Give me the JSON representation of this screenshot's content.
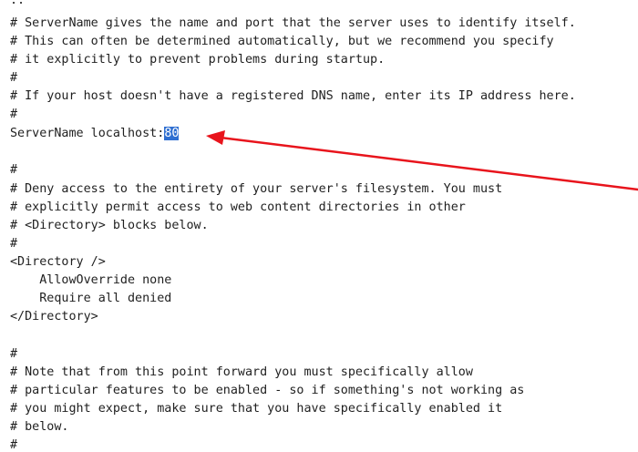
{
  "editor": {
    "lines": [
      "..",
      "# ServerName gives the name and port that the server uses to identify itself.",
      "# This can often be determined automatically, but we recommend you specify",
      "# it explicitly to prevent problems during startup.",
      "#",
      "# If your host doesn't have a registered DNS name, enter its IP address here.",
      "#",
      "",
      "",
      "#",
      "# Deny access to the entirety of your server's filesystem. You must",
      "# explicitly permit access to web content directories in other",
      "# <Directory> blocks below.",
      "#",
      "<Directory />",
      "    AllowOverride none",
      "    Require all denied",
      "</Directory>",
      "",
      "#",
      "# Note that from this point forward you must specifically allow",
      "# particular features to be enabled - so if something's not working as",
      "# you might expect, make sure that you have specifically enabled it",
      "# below.",
      "#"
    ],
    "servername_prefix": "ServerName localhost:",
    "servername_port": "80"
  },
  "annotation": {
    "arrow_color": "#e8141c"
  }
}
